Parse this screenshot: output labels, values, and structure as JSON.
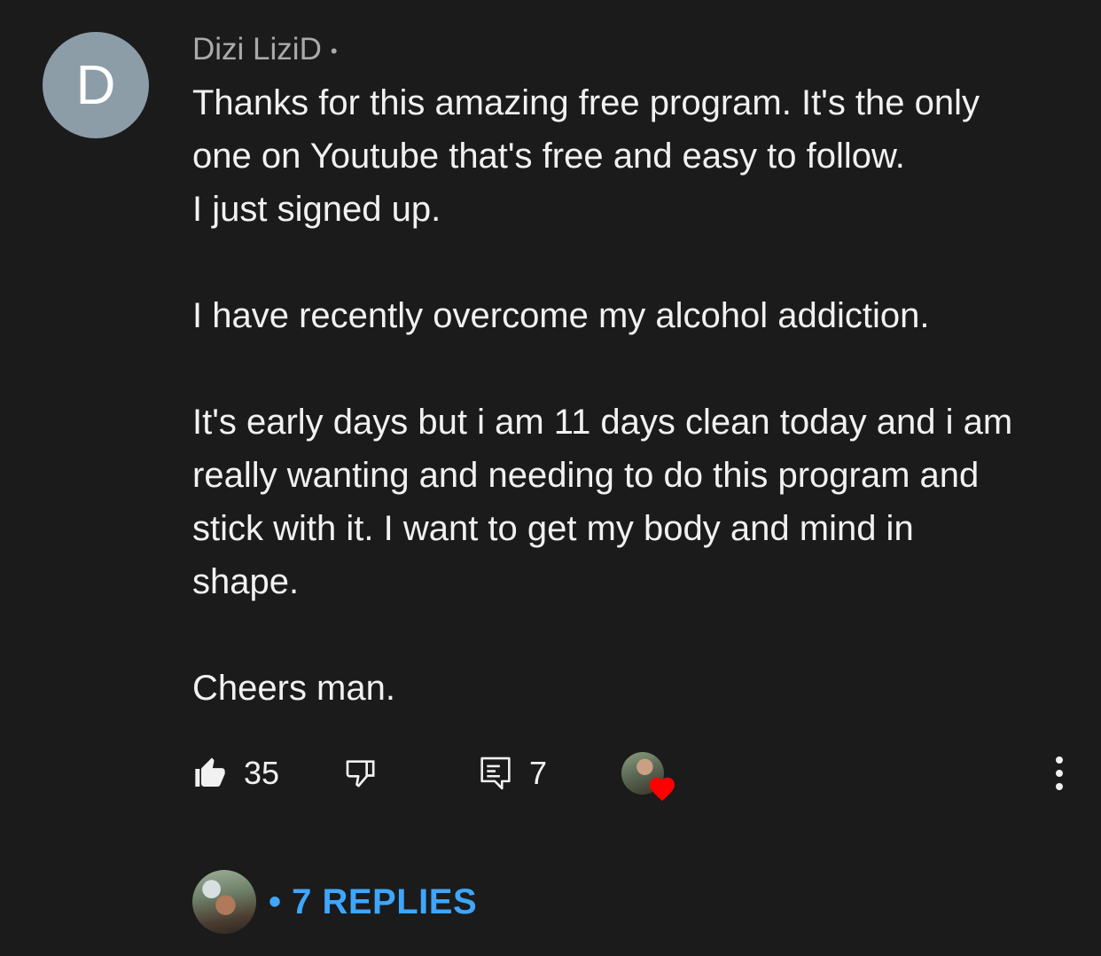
{
  "comment": {
    "avatar_letter": "D",
    "author": "Dizi LiziD",
    "separator": "•",
    "lines": [
      "Thanks for this amazing free program. It's the only",
      "one on Youtube that's free and easy to follow.",
      "I just signed up.",
      "",
      "I have recently overcome my alcohol addiction.",
      "",
      "It's early days but i am 11 days clean today and i am",
      "really wanting and needing to do this program and",
      "stick with it. I want to get my body and mind in",
      "shape.",
      "",
      "Cheers man."
    ],
    "like_count": "35",
    "reply_count": "7",
    "replies_link": "• 7 REPLIES"
  },
  "colors": {
    "background": "#1b1b1b",
    "avatar_bg": "#8c9da8",
    "link": "#3ea6ff",
    "heart": "#ff0000",
    "meta_text": "#aaaaaa"
  },
  "icons": {
    "like": "thumbs-up-icon",
    "dislike": "thumbs-down-icon",
    "reply": "comment-icon",
    "heart": "heart-icon",
    "more": "more-vertical-icon"
  }
}
